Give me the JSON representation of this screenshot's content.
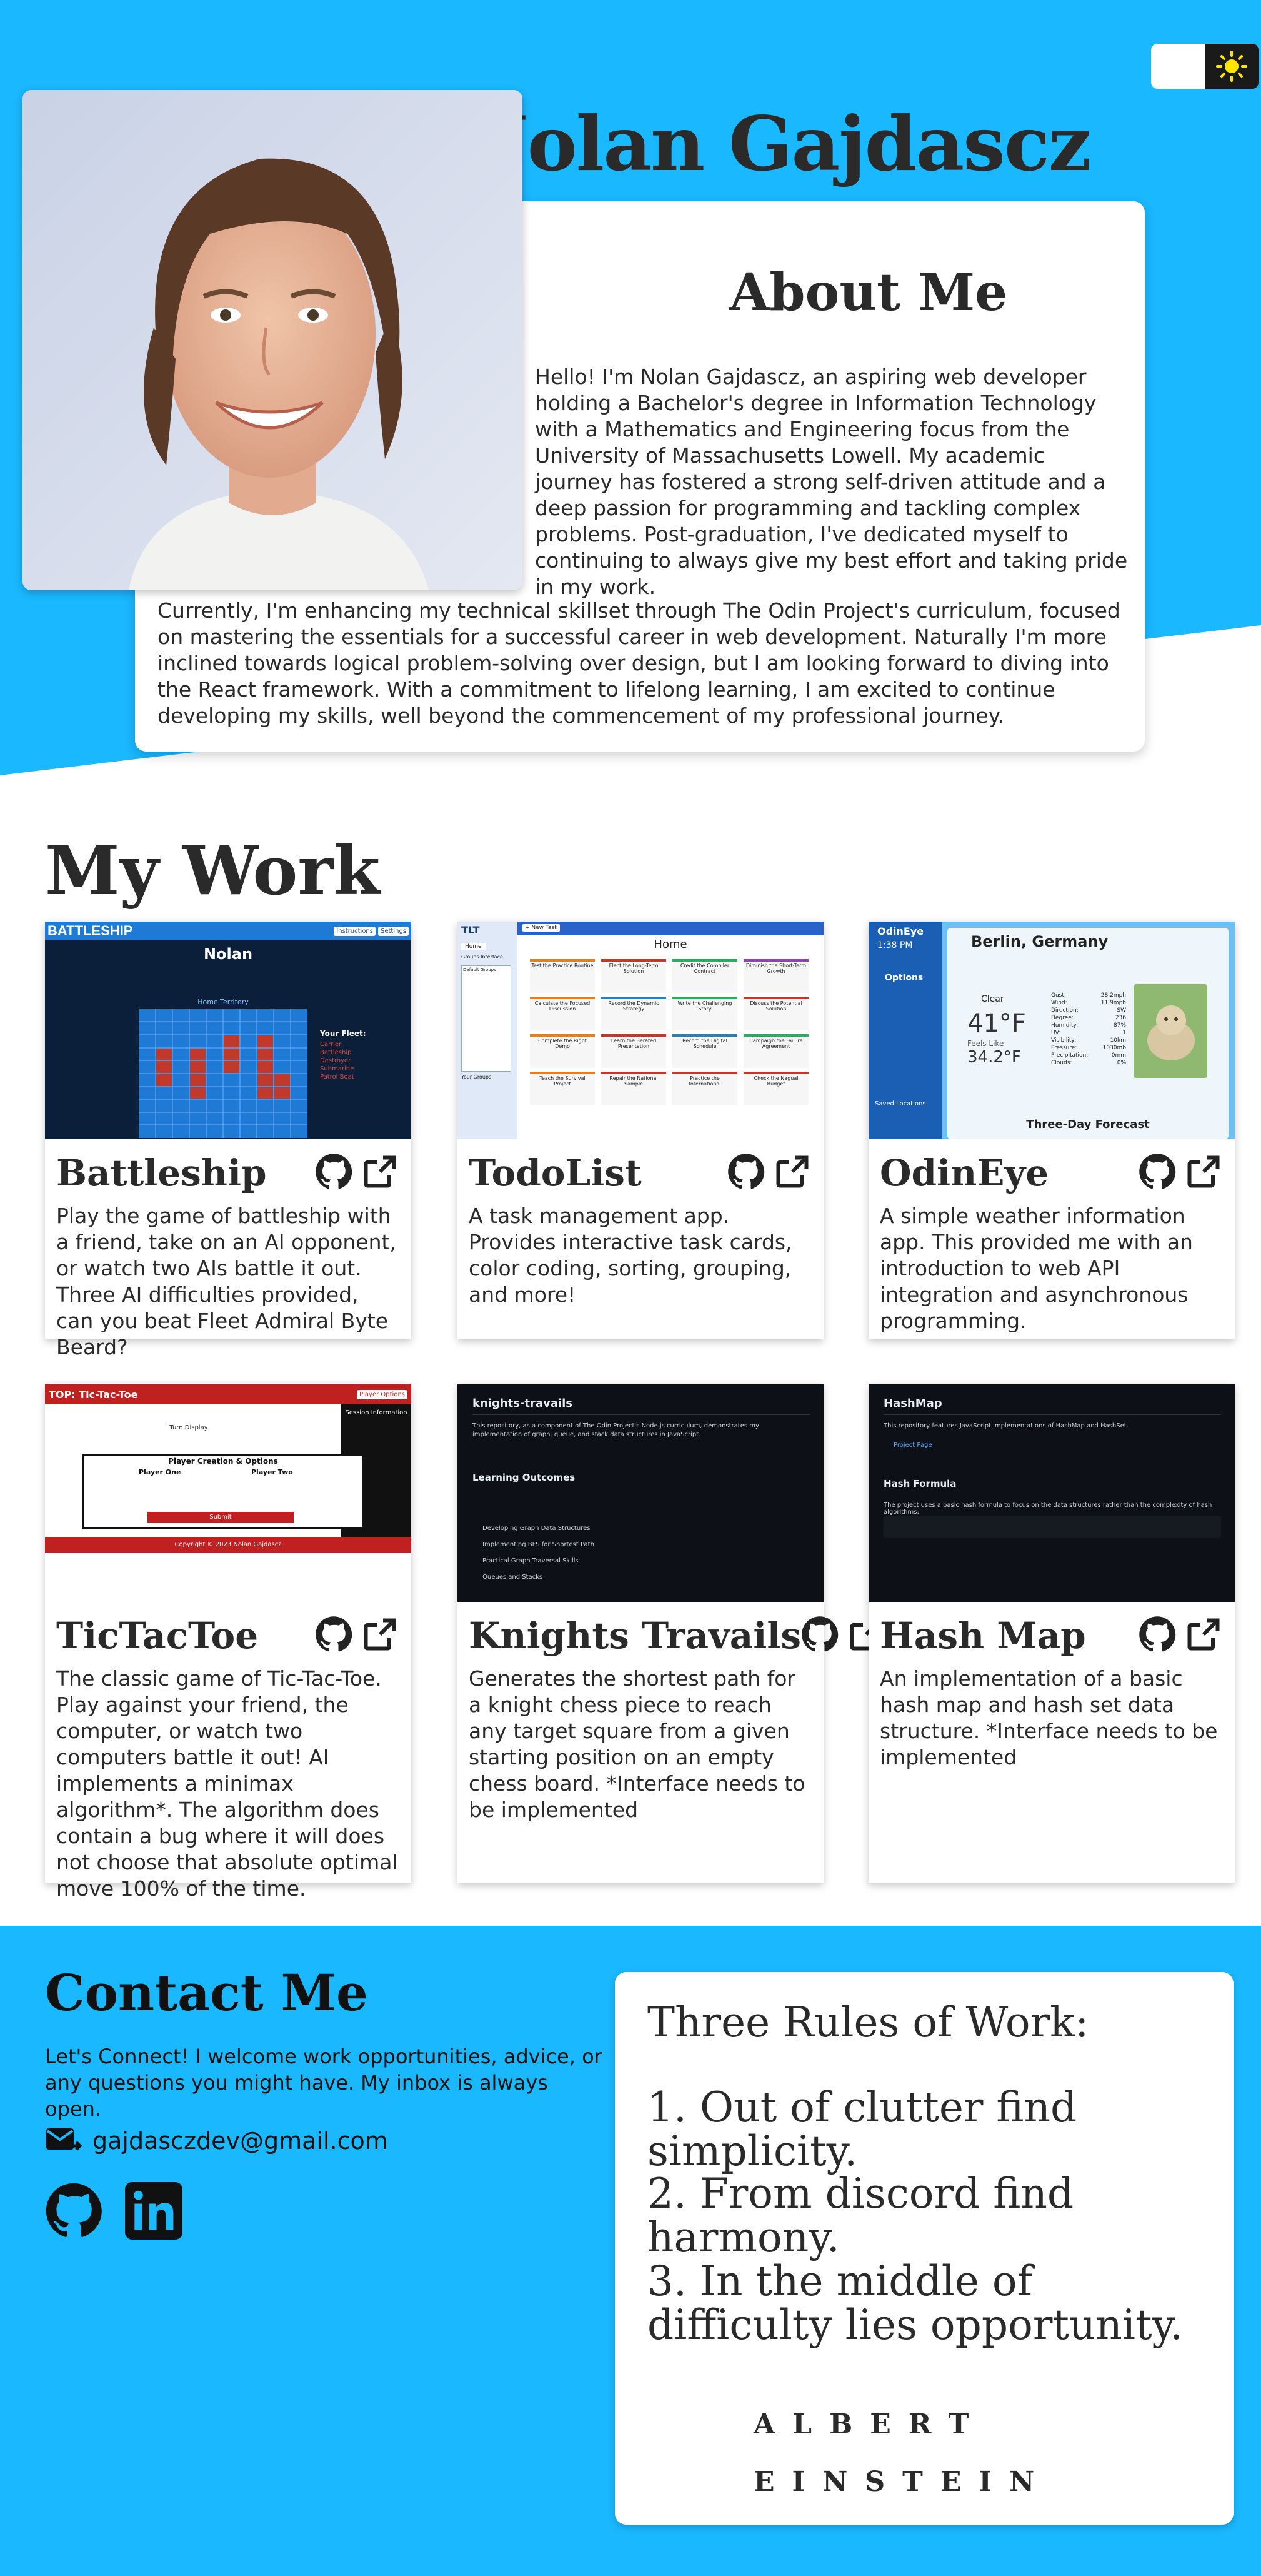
{
  "header": {
    "title": "Nolan Gajdascz",
    "toggle_icon": "sun-icon"
  },
  "about": {
    "title": "About Me",
    "paragraph1": "Hello! I'm Nolan Gajdascz, an aspiring web developer holding a Bachelor's degree in Information Technology with a Mathematics and Engineering focus from the University of Massachusetts Lowell. My academic journey has fostered a strong self-driven attitude and a deep passion for programming and tackling complex problems. Post-graduation, I've dedicated myself to continuing to always give my best effort and taking pride in my work.",
    "paragraph2": "Currently, I'm enhancing my technical skillset through The Odin Project's curriculum, focused on mastering the essentials for a successful career in web development. Naturally I'm more inclined towards logical problem-solving over design, but I am looking forward to diving into the React framework. With a commitment to lifelong learning, I am excited to continue developing my skills, well beyond the commencement of my professional journey."
  },
  "work": {
    "title": "My Work",
    "projects": [
      {
        "name": "Battleship",
        "description": "Play the game of battleship with a friend, take on an AI opponent, or watch two AIs battle it out. Three AI difficulties provided, can you beat Fleet Admiral Byte Beard?"
      },
      {
        "name": "TodoList",
        "description": "A task management app. Provides interactive task cards, color coding, sorting, grouping, and more!"
      },
      {
        "name": "OdinEye",
        "description": "A simple weather information app. This provided me with an introduction to web API integration and asynchronous programming."
      },
      {
        "name": "TicTacToe",
        "description": "The classic game of Tic-Tac-Toe. Play against your friend, the computer, or watch two computers battle it out! AI implements a minimax algorithm*. The algorithm does contain a bug where it will does not choose that absolute optimal move 100% of the time."
      },
      {
        "name": "Knights Travails",
        "description": "Generates the shortest path for a knight chess piece to reach any target square from a given starting position on an empty chess board. *Interface needs to be implemented"
      },
      {
        "name": "Hash Map",
        "description": "An implementation of a basic hash map and hash set data structure. *Interface needs to be implemented"
      }
    ]
  },
  "thumbs": {
    "battleship": {
      "app_title": "BATTLESHIP",
      "btn1": "Instructions",
      "btn2": "Settings",
      "player": "Nolan",
      "territory": "Home Territory",
      "fleet_title": "Your Fleet:",
      "fleet": [
        "Carrier",
        "Battleship",
        "Destroyer",
        "Submarine",
        "Patrol Boat"
      ]
    },
    "todolist": {
      "logo": "TLT",
      "new_task": "+ New Task",
      "home": "Home",
      "side_home": "Home",
      "groups": "Groups Interface",
      "default": "Default Groups",
      "your_groups": "Your Groups",
      "cards": [
        "Test the Practice Routine",
        "Elect the Long-Term Solution",
        "Credit the Compiler Contract",
        "Diminish the Short-Term Growth",
        "Calculate the Focused Discussion",
        "Record the Dynamic Strategy",
        "Write the Challenging Story",
        "Discuss the Potential Solution",
        "Complete the Right Demo",
        "Learn the Berated Presentation",
        "Record the Digital Schedule",
        "Campaign the Failure Agreement",
        "Teach the Survival Project",
        "Repair the National Sample",
        "Practice the International",
        "Check the Nagual Budget"
      ]
    },
    "odineye": {
      "app": "OdinEye",
      "time": "1:38 PM",
      "options": "Options",
      "saved": "Saved Locations",
      "location": "Berlin, Germany",
      "condition": "Clear",
      "temp": "41°F",
      "feels_label": "Feels Like",
      "feels": "34.2°F",
      "forecast": "Three-Day Forecast",
      "stats": [
        [
          "Gust:",
          "28.2mph"
        ],
        [
          "Wind:",
          "11.9mph"
        ],
        [
          "Direction:",
          "SW"
        ],
        [
          "Degree:",
          "236"
        ],
        [
          "Humidity:",
          "87%"
        ],
        [
          "UV:",
          "1"
        ],
        [
          "Visibility:",
          "10km"
        ],
        [
          "Pressure:",
          "1030mb"
        ],
        [
          "Precipitation:",
          "0mm"
        ],
        [
          "Clouds:",
          "0%"
        ]
      ]
    },
    "tictactoe": {
      "title": "TOP: Tic-Tac-Toe",
      "options_btn": "Player Options",
      "session": "Session Information",
      "turn": "Turn Display",
      "dialog_title": "Player Creation & Options",
      "p1": "Player One",
      "p2": "Player Two",
      "submit": "Submit",
      "footer": "Copyright © 2023 Nolan Gajdascz"
    },
    "knights": {
      "title": "knights-travails",
      "intro": "This repository, as a component of The Odin Project's Node.js curriculum, demonstrates my implementation of graph, queue, and stack data structures in JavaScript.",
      "outcomes": "Learning Outcomes",
      "items": [
        "Developing Graph Data Structures",
        "Implementing BFS for Shortest Path",
        "Practical Graph Traversal Skills",
        "Queues and Stacks"
      ]
    },
    "hashmap": {
      "title": "HashMap",
      "intro": "This repository features JavaScript implementations of HashMap and HashSet.",
      "page": "Project Page",
      "formula": "Hash Formula",
      "formula_text": "The project uses a basic hash formula to focus on the data structures rather than the complexity of hash algorithms:"
    }
  },
  "contact": {
    "title": "Contact Me",
    "text": "Let's Connect! I welcome work opportunities, advice, or any questions you might have. My inbox is always open.",
    "email": "gajdasczdev@gmail.com",
    "socials": [
      "github-icon",
      "linkedin-icon"
    ]
  },
  "rules": {
    "heading": "Three Rules of Work:",
    "items": [
      "1. Out of clutter find simplicity.",
      "2. From discord find harmony.",
      "3. In the middle of difficulty lies opportunity."
    ],
    "signature_line1": "ALBERT",
    "signature_line2": "EINSTEIN"
  },
  "colors": {
    "accent": "#1ab8ff",
    "card": "#ffffff",
    "text": "#2a2a2a"
  }
}
